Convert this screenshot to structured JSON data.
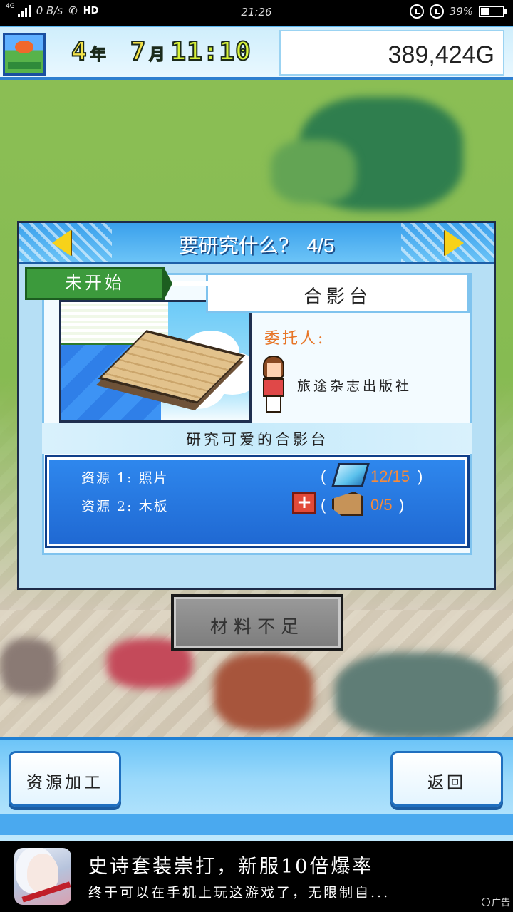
{
  "statusbar": {
    "network": "4G",
    "speed": "0 B/s",
    "hd": "HD",
    "time": "21:26",
    "battery": "39%"
  },
  "hud": {
    "year_num": "4",
    "year_unit": "年",
    "month_num": "7",
    "month_unit": "月",
    "clock": "11:10",
    "money": "389,424G"
  },
  "dialog": {
    "title": "要研究什么?",
    "page": "4/5",
    "status": "未开始",
    "item_name": "合影台",
    "client_label": "委托人:",
    "client_name": "旅途杂志出版社",
    "description": "研究可爱的合影台",
    "resources": [
      {
        "label": "资源 1: 照片",
        "icon": "photo-icon",
        "count": "12/15",
        "open": "(",
        "close": ")"
      },
      {
        "label": "资源 2: 木板",
        "icon": "plank-icon",
        "count": "0/5",
        "open": "(",
        "close": ")"
      }
    ],
    "add_label": "+",
    "action_label": "材料不足"
  },
  "bottom": {
    "process_label": "资源加工",
    "back_label": "返回"
  },
  "ad": {
    "title": "史诗套装崇打，新服10倍爆率",
    "desc": "终于可以在手机上玩这游戏了，无限制自...",
    "tag": "广告"
  },
  "colors": {
    "accent_blue": "#2f88ee",
    "status_green": "#3c9a3c",
    "client_orange": "#e77527",
    "count_orange": "#f58a3a",
    "arrow_yellow": "#f7d21a"
  }
}
